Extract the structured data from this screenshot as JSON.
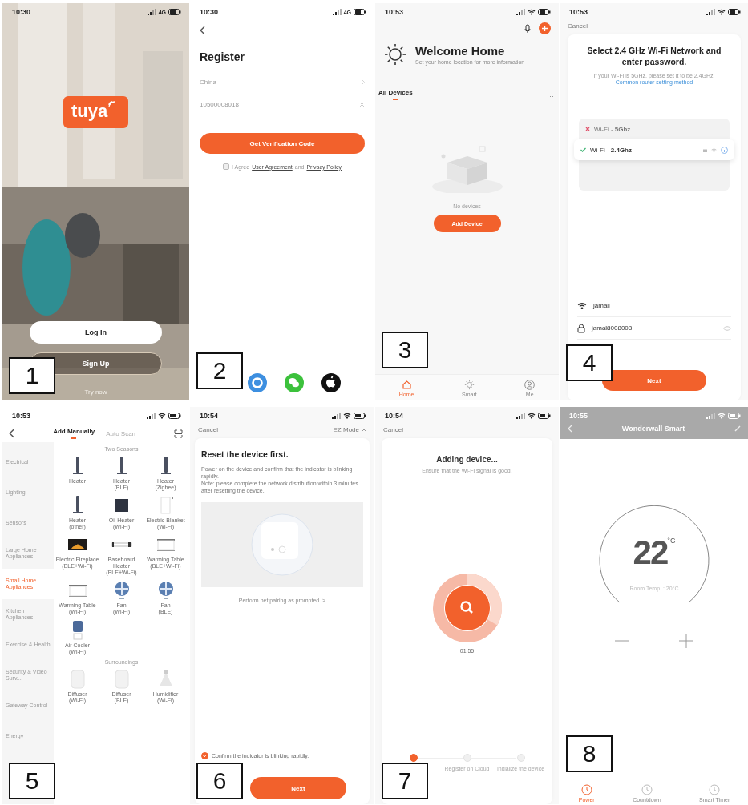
{
  "screens": [
    {
      "kind": "splash",
      "number": "1",
      "status": {
        "time": "10:30",
        "network": "4G"
      },
      "logo": "tuya",
      "buttons": [
        {
          "label": "Log In",
          "kind": "solid"
        },
        {
          "label": "Sign Up",
          "kind": "outline"
        }
      ],
      "link": "Try now"
    },
    {
      "kind": "register",
      "number": "2",
      "status": {
        "time": "10:30",
        "network": "4G"
      },
      "title": "Register",
      "country": "China",
      "phone": "10500008018",
      "action": "Get Verification Code",
      "agreement": {
        "checked": false,
        "prefix": "I Agree",
        "links": [
          "User Agreement",
          "Privacy Policy"
        ],
        "joiner": "and"
      },
      "social": [
        {
          "kind": "bubble",
          "color": "#3d8fe0"
        },
        {
          "kind": "chat",
          "color": "#3cc13c"
        },
        {
          "kind": "apple",
          "color": "#111111"
        }
      ]
    },
    {
      "kind": "home",
      "number": "3",
      "status": {
        "time": "10:53"
      },
      "title": "Welcome Home",
      "subtitle": "Set your home location for more information",
      "section": "All Devices",
      "more": "···",
      "empty": "No devices",
      "action": "Add Device",
      "tabs": [
        {
          "label": "Home",
          "selected": true
        },
        {
          "label": "Smart",
          "selected": false
        },
        {
          "label": "Me",
          "selected": false
        }
      ]
    },
    {
      "kind": "wifi",
      "number": "4",
      "status": {
        "time": "10:53"
      },
      "cancel": "Cancel",
      "title": "Select 2.4 GHz Wi-Fi Network and enter password.",
      "hint": "If your Wi-Fi is 5GHz, please set it to be 2.4GHz.",
      "link": "Common router setting method",
      "networks": [
        {
          "name": "Wi-Fi - **5Ghz**",
          "supported": false,
          "selected": false
        },
        {
          "name": "Wi-Fi - **2.4Ghz**",
          "supported": true,
          "selected": true
        }
      ],
      "ssid": "jamall",
      "password": "jamal8008008",
      "action": "Next"
    },
    {
      "kind": "catalog",
      "number": "5",
      "status": {
        "time": "10:53"
      },
      "tabs": [
        {
          "label": "Add Manually",
          "selected": true
        },
        {
          "label": "Auto Scan",
          "selected": false
        }
      ],
      "categories": [
        {
          "label": "Electrical",
          "selected": false
        },
        {
          "label": "Lighting",
          "selected": false
        },
        {
          "label": "Sensors",
          "selected": false
        },
        {
          "label": "Large Home Appliances",
          "selected": false
        },
        {
          "label": "Small Home Appliances",
          "selected": true
        },
        {
          "label": "Kitchen Appliances",
          "selected": false
        },
        {
          "label": "Exercise & Health",
          "selected": false
        },
        {
          "label": "Security & Video Surv...",
          "selected": false
        },
        {
          "label": "Gateway Control",
          "selected": false
        },
        {
          "label": "Energy",
          "selected": false
        }
      ],
      "sections": [
        {
          "title": "Two Seasons",
          "devices": [
            {
              "name": "Heater",
              "kind": "tower"
            },
            {
              "name": "Heater",
              "protocol": "(BLE)",
              "kind": "tower"
            },
            {
              "name": "Heater",
              "protocol": "(Zigbee)",
              "kind": "tower"
            },
            {
              "name": "Heater",
              "protocol": "(other)",
              "kind": "tower"
            },
            {
              "name": "Oil Heater",
              "protocol": "(Wi-Fi)",
              "kind": "panel"
            },
            {
              "name": "Electric Blanket",
              "protocol": "(Wi-Fi)",
              "kind": "blanket"
            },
            {
              "name": "Electric Fireplace",
              "protocol": "(BLE+Wi-Fi)",
              "kind": "fireplace"
            },
            {
              "name": "Baseboard Heater",
              "protocol": "(BLE+Wi-Fi)",
              "kind": "baseboard"
            },
            {
              "name": "Warming Table",
              "protocol": "(BLE+Wi-Fi)",
              "kind": "table"
            },
            {
              "name": "Warming Table",
              "protocol": "(Wi-Fi)",
              "kind": "table"
            },
            {
              "name": "Fan",
              "protocol": "(Wi-Fi)",
              "kind": "fan"
            },
            {
              "name": "Fan",
              "protocol": "(BLE)",
              "kind": "fan"
            },
            {
              "name": "Air Cooler",
              "protocol": "(Wi-Fi)",
              "kind": "cooler"
            }
          ]
        },
        {
          "title": "Surroundings",
          "devices": [
            {
              "name": "Diffuser",
              "protocol": "(Wi-Fi)",
              "kind": "diffuser"
            },
            {
              "name": "Diffuser",
              "protocol": "(BLE)",
              "kind": "diffuser"
            },
            {
              "name": "Humidifier",
              "protocol": "(Wi-Fi)",
              "kind": "humidifier"
            }
          ]
        }
      ]
    },
    {
      "kind": "reset",
      "number": "6",
      "status": {
        "time": "10:54"
      },
      "cancel": "Cancel",
      "mode": "EZ Mode",
      "title": "Reset the device first.",
      "paragraphs": [
        "Power on the device and confirm that the indicator is blinking rapidly.",
        "Note: please complete the network distribution within 3 minutes after resetting the device."
      ],
      "link": "Perform net pairing as prompted. >",
      "confirm": {
        "label": "Confirm the indicator is blinking rapidly.",
        "checked": true
      },
      "action": "Next"
    },
    {
      "kind": "adding",
      "number": "7",
      "status": {
        "time": "10:54"
      },
      "cancel": "Cancel",
      "title": "Adding device...",
      "subtitle": "Ensure that the Wi-Fi signal is good.",
      "timer": "01:55",
      "steps": [
        {
          "selected": true
        },
        {
          "label": "Register on Cloud",
          "selected": false
        },
        {
          "label": "Initialize the device",
          "selected": false
        }
      ]
    },
    {
      "kind": "thermostat",
      "number": "8",
      "status": {
        "time": "10:55"
      },
      "title": "Wonderwall Smart",
      "temperature": "22",
      "unit": "°C",
      "room": "Room Temp. : 20°C",
      "tabs": [
        {
          "label": "Power",
          "selected": true
        },
        {
          "label": "Countdown",
          "selected": false
        },
        {
          "label": "Smart Timer",
          "selected": false
        }
      ]
    }
  ]
}
